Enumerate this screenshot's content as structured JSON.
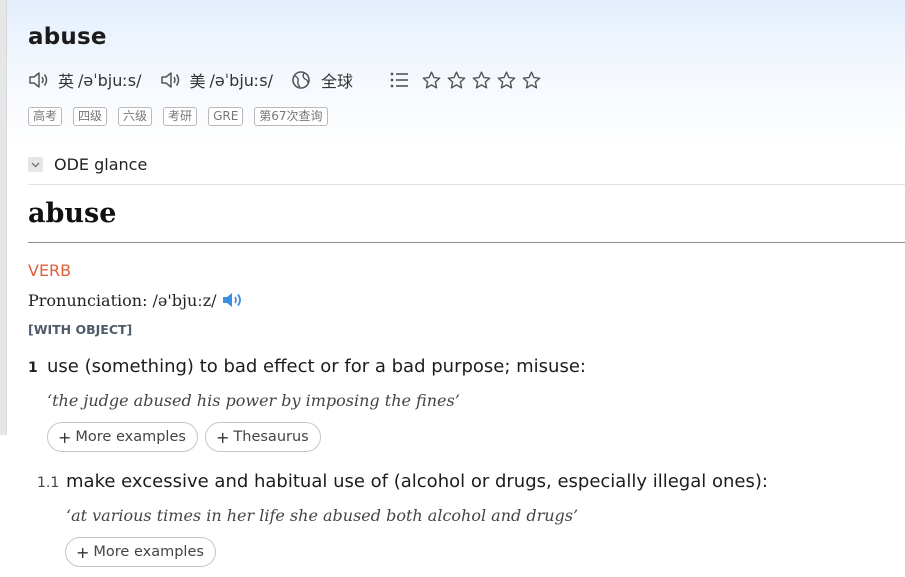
{
  "entry": {
    "headword": "abuse",
    "uk_label": "英",
    "uk_ipa": "/əˈbjuːs/",
    "us_label": "美",
    "us_ipa": "/əˈbjuːs/",
    "region_label": "全球",
    "stars_filled": 0,
    "stars_total": 5
  },
  "tags": [
    "高考",
    "四级",
    "六级",
    "考研",
    "GRE",
    "第67次查询"
  ],
  "glance": {
    "label": "ODE glance"
  },
  "ode": {
    "title": "abuse",
    "pos": "VERB",
    "pronunciation_label": "Pronunciation: /ə'bjuːz/",
    "grammar": "[WITH OBJECT]",
    "senses": [
      {
        "num": "1",
        "definition": "use (something) to bad effect or for a bad purpose; misuse:",
        "example": "‘the judge abused his power by imposing the fines’",
        "more_examples": "More examples",
        "thesaurus": "Thesaurus"
      },
      {
        "num": "1.1",
        "definition": "make excessive and habitual use of (alcohol or drugs, especially illegal ones):",
        "example": "‘at various times in her life she abused both alcohol and drugs’",
        "more_examples": "More examples"
      }
    ]
  },
  "colors": {
    "pos": "#e0603a",
    "speaker_blue": "#3d8fe0",
    "grammar": "#4f5b6b"
  }
}
